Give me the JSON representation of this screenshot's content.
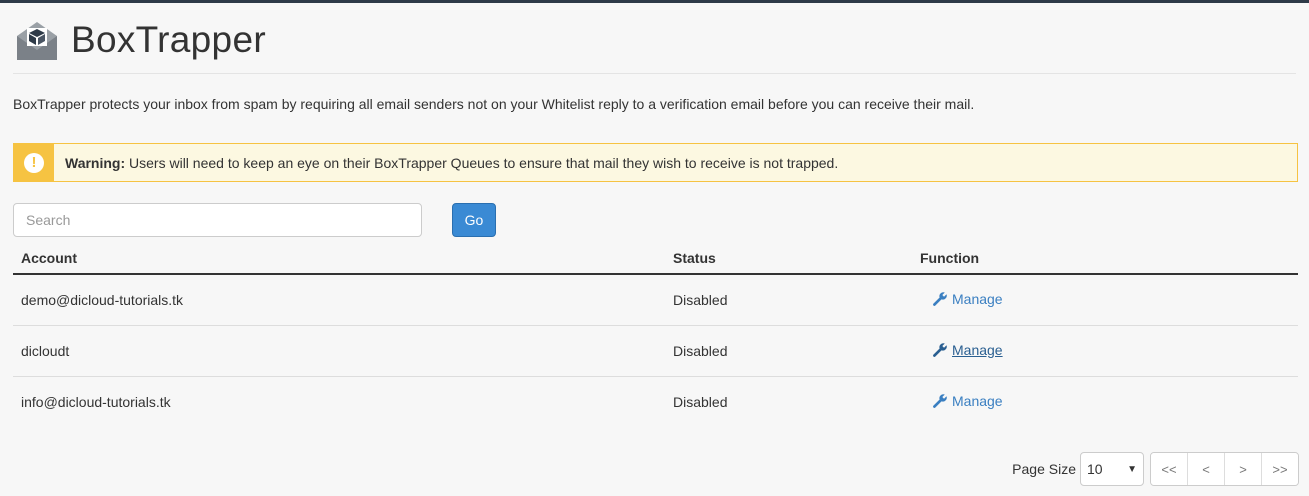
{
  "header": {
    "title": "BoxTrapper",
    "icon": "boxtrapper-envelope-icon"
  },
  "description": "BoxTrapper protects your inbox from spam by requiring all email senders not on your Whitelist reply to a verification email before you can receive their mail.",
  "warning": {
    "label": "Warning:",
    "message": "Users will need to keep an eye on their BoxTrapper Queues to ensure that mail they wish to receive is not trapped.",
    "icon": "exclamation-icon",
    "color": "#f6c342"
  },
  "search": {
    "placeholder": "Search",
    "value": "",
    "button_label": "Go"
  },
  "table": {
    "headers": {
      "account": "Account",
      "status": "Status",
      "function": "Function"
    },
    "rows": [
      {
        "account": "demo@dicloud-tutorials.tk",
        "status": "Disabled",
        "action": "Manage"
      },
      {
        "account": "dicloudt",
        "status": "Disabled",
        "action": "Manage"
      },
      {
        "account": "info@dicloud-tutorials.tk",
        "status": "Disabled",
        "action": "Manage"
      }
    ]
  },
  "pager": {
    "page_size_label": "Page Size",
    "page_size": "10",
    "first": "<<",
    "prev": "<",
    "next": ">",
    "last": ">>"
  },
  "colors": {
    "accent": "#3a8ad4",
    "link": "#3a7fc1",
    "warning": "#f6c342"
  }
}
